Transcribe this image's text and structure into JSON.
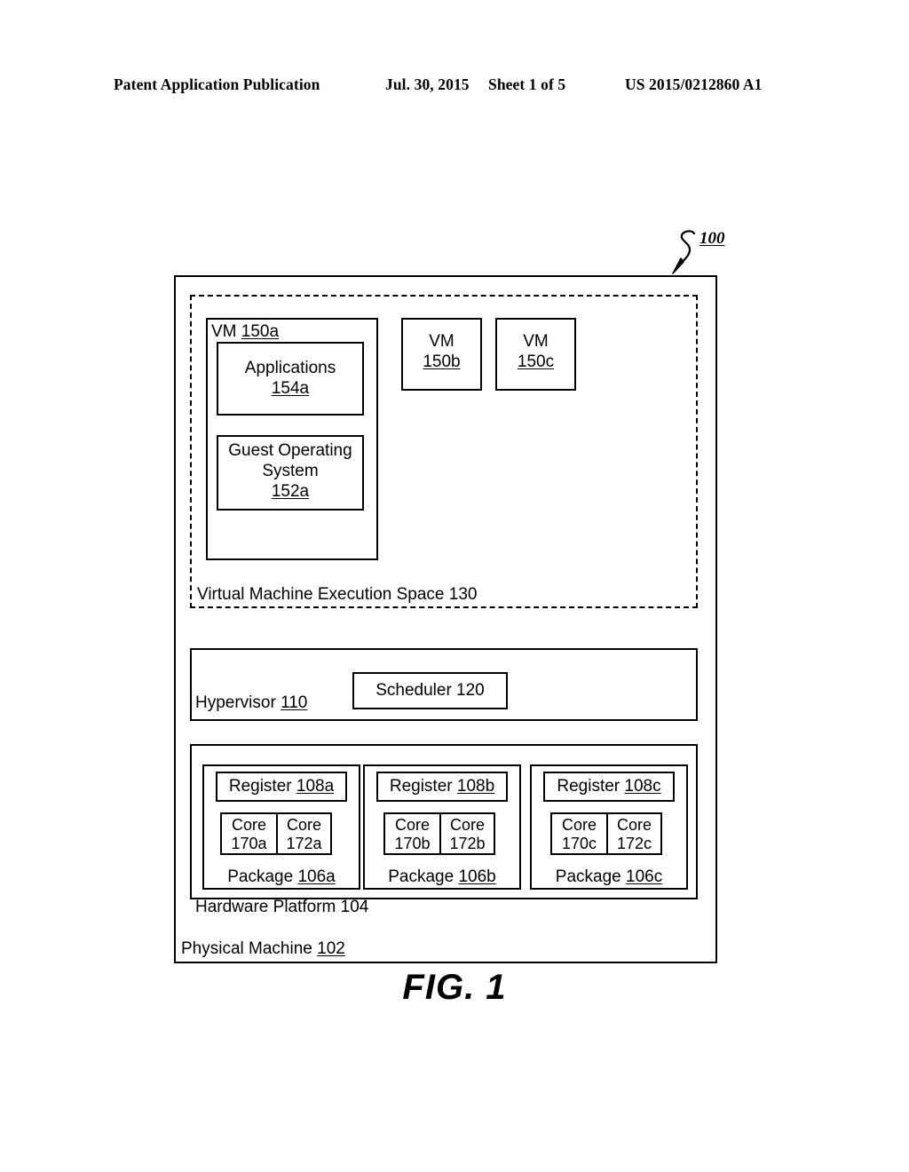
{
  "header": {
    "publication": "Patent Application Publication",
    "date": "Jul. 30, 2015",
    "sheet": "Sheet 1 of 5",
    "patent_number": "US 2015/0212860 A1"
  },
  "figure": {
    "caption": "FIG. 1",
    "reference_numeral": "100"
  },
  "diagram": {
    "physical_machine": {
      "label": "Physical Machine ",
      "ref": "102"
    },
    "vm_execution_space": {
      "label": "Virtual Machine Execution Space 130"
    },
    "vm_150a": {
      "label": "VM ",
      "ref": "150a",
      "applications": {
        "label": "Applications",
        "ref": "154a"
      },
      "guest_os": {
        "line1": "Guest Operating",
        "line2": "System",
        "ref": "152a"
      }
    },
    "vm_150b": {
      "label": "VM",
      "ref": "150b"
    },
    "vm_150c": {
      "label": "VM",
      "ref": "150c"
    },
    "hypervisor": {
      "label": "Hypervisor ",
      "ref": "110",
      "scheduler": {
        "label": "Scheduler 120"
      }
    },
    "hardware_platform": {
      "label": "Hardware Platform 104",
      "packages": [
        {
          "register_label": "Register ",
          "register_ref": "108a",
          "core_left_line1": "Core",
          "core_left_line2": "170a",
          "core_right_line1": "Core",
          "core_right_line2": "172a",
          "package_label": "Package ",
          "package_ref": "106a"
        },
        {
          "register_label": "Register ",
          "register_ref": "108b",
          "core_left_line1": "Core",
          "core_left_line2": "170b",
          "core_right_line1": "Core",
          "core_right_line2": "172b",
          "package_label": "Package ",
          "package_ref": "106b"
        },
        {
          "register_label": "Register ",
          "register_ref": "108c",
          "core_left_line1": "Core",
          "core_left_line2": "170c",
          "core_right_line1": "Core",
          "core_right_line2": "172c",
          "package_label": "Package ",
          "package_ref": "106c"
        }
      ]
    }
  },
  "colors": {
    "ink": "#000000",
    "paper": "#ffffff"
  }
}
